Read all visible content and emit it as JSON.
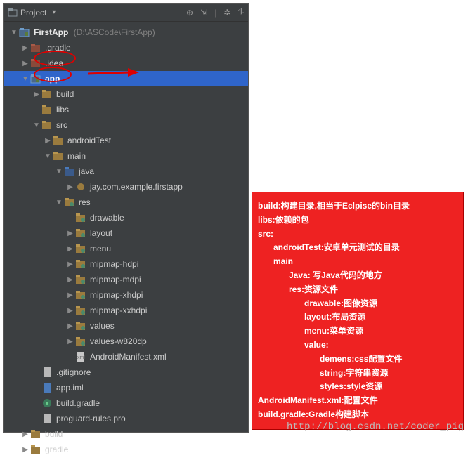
{
  "header": {
    "title": "Project",
    "icons": [
      "target-icon",
      "collapse-icon",
      "settings-icon",
      "hide-icon"
    ]
  },
  "root": {
    "name": "FirstApp",
    "path": "(D:\\ASCode\\FirstApp)"
  },
  "tree": [
    {
      "depth": 0,
      "exp": "open",
      "icon": "module",
      "bold": true,
      "label": "FirstApp",
      "path": "(D:\\ASCode\\FirstApp)"
    },
    {
      "depth": 1,
      "exp": "closed",
      "icon": "folder-red",
      "label": ".gradle"
    },
    {
      "depth": 1,
      "exp": "closed",
      "icon": "folder-red",
      "label": ".idea"
    },
    {
      "depth": 1,
      "exp": "open",
      "icon": "module",
      "bold": true,
      "label": "app",
      "selected": true
    },
    {
      "depth": 2,
      "exp": "closed",
      "icon": "folder",
      "label": "build"
    },
    {
      "depth": 2,
      "exp": "",
      "icon": "folder",
      "label": "libs"
    },
    {
      "depth": 2,
      "exp": "open",
      "icon": "folder",
      "label": "src"
    },
    {
      "depth": 3,
      "exp": "closed",
      "icon": "folder",
      "label": "androidTest"
    },
    {
      "depth": 3,
      "exp": "open",
      "icon": "folder",
      "label": "main"
    },
    {
      "depth": 4,
      "exp": "open",
      "icon": "folder-blue",
      "label": "java"
    },
    {
      "depth": 5,
      "exp": "closed",
      "icon": "package",
      "label": "jay.com.example.firstapp"
    },
    {
      "depth": 4,
      "exp": "open",
      "icon": "folder-res",
      "label": "res"
    },
    {
      "depth": 5,
      "exp": "",
      "icon": "folder-res",
      "label": "drawable"
    },
    {
      "depth": 5,
      "exp": "closed",
      "icon": "folder-res",
      "label": "layout"
    },
    {
      "depth": 5,
      "exp": "closed",
      "icon": "folder-res",
      "label": "menu"
    },
    {
      "depth": 5,
      "exp": "closed",
      "icon": "folder-res",
      "label": "mipmap-hdpi"
    },
    {
      "depth": 5,
      "exp": "closed",
      "icon": "folder-res",
      "label": "mipmap-mdpi"
    },
    {
      "depth": 5,
      "exp": "closed",
      "icon": "folder-res",
      "label": "mipmap-xhdpi"
    },
    {
      "depth": 5,
      "exp": "closed",
      "icon": "folder-res",
      "label": "mipmap-xxhdpi"
    },
    {
      "depth": 5,
      "exp": "closed",
      "icon": "folder-res",
      "label": "values"
    },
    {
      "depth": 5,
      "exp": "closed",
      "icon": "folder-res",
      "label": "values-w820dp"
    },
    {
      "depth": 5,
      "exp": "",
      "icon": "xml",
      "label": "AndroidManifest.xml"
    },
    {
      "depth": 2,
      "exp": "",
      "icon": "file",
      "label": ".gitignore"
    },
    {
      "depth": 2,
      "exp": "",
      "icon": "iml",
      "label": "app.iml"
    },
    {
      "depth": 2,
      "exp": "",
      "icon": "gradle",
      "label": "build.gradle"
    },
    {
      "depth": 2,
      "exp": "",
      "icon": "file",
      "label": "proguard-rules.pro"
    },
    {
      "depth": 1,
      "exp": "closed",
      "icon": "folder",
      "label": "build"
    },
    {
      "depth": 1,
      "exp": "closed",
      "icon": "folder",
      "label": "gradle"
    }
  ],
  "notes": [
    {
      "indent": 0,
      "text": "build:构建目录,相当于Eclpise的bin目录"
    },
    {
      "indent": 0,
      "text": "libs:依赖的包"
    },
    {
      "indent": 0,
      "text": "src:"
    },
    {
      "indent": 1,
      "text": "androidTest:安卓单元测试的目录"
    },
    {
      "indent": 1,
      "text": "main"
    },
    {
      "indent": 2,
      "text": "Java: 写Java代码的地方"
    },
    {
      "indent": 2,
      "text": "res:资源文件"
    },
    {
      "indent": 3,
      "text": "drawable:图像资源"
    },
    {
      "indent": 3,
      "text": "layout:布局资源"
    },
    {
      "indent": 3,
      "text": "menu:菜单资源"
    },
    {
      "indent": 3,
      "text": "value:"
    },
    {
      "indent": 4,
      "text": "demens:css配置文件"
    },
    {
      "indent": 4,
      "text": "string:字符串资源"
    },
    {
      "indent": 4,
      "text": "styles:style资源"
    },
    {
      "indent": 0,
      "text": "AndroidManifest.xml:配置文件"
    },
    {
      "indent": 0,
      "text": "build.gradle:Gradle构建脚本"
    }
  ],
  "watermark": "http://blog.csdn.net/coder_pig"
}
